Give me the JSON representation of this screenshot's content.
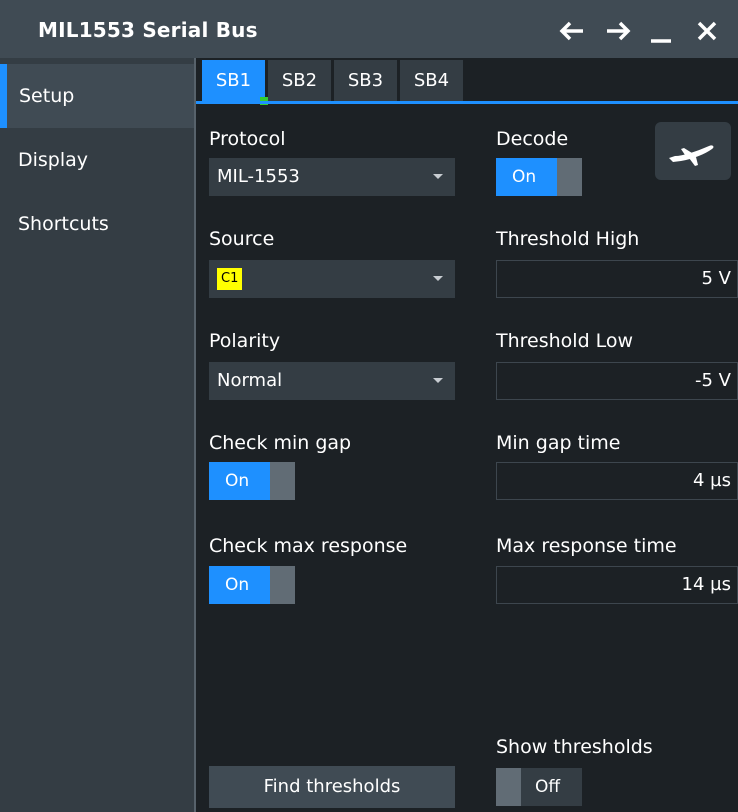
{
  "window": {
    "title": "MIL1553 Serial Bus",
    "controls": [
      "back-arrow-icon",
      "forward-arrow-icon",
      "minimize-icon",
      "close-icon"
    ]
  },
  "sidebar": {
    "items": [
      {
        "label": "Setup",
        "active": true
      },
      {
        "label": "Display",
        "active": false
      },
      {
        "label": "Shortcuts",
        "active": false
      }
    ]
  },
  "tabs": [
    {
      "label": "SB1",
      "active": true
    },
    {
      "label": "SB2",
      "active": false
    },
    {
      "label": "SB3",
      "active": false
    },
    {
      "label": "SB4",
      "active": false
    }
  ],
  "form": {
    "protocol": {
      "label": "Protocol",
      "value": "MIL-1553"
    },
    "decode": {
      "label": "Decode",
      "value": "On"
    },
    "source": {
      "label": "Source",
      "value": "C1"
    },
    "threshold_high": {
      "label": "Threshold High",
      "value": "5 V"
    },
    "polarity": {
      "label": "Polarity",
      "value": "Normal"
    },
    "threshold_low": {
      "label": "Threshold Low",
      "value": "-5 V"
    },
    "check_min_gap": {
      "label": "Check min gap",
      "value": "On"
    },
    "min_gap_time": {
      "label": "Min gap time",
      "value": "4 µs"
    },
    "check_max_response": {
      "label": "Check max response",
      "value": "On"
    },
    "max_response_time": {
      "label": "Max response time",
      "value": "14 µs"
    },
    "show_thresholds": {
      "label": "Show thresholds",
      "value": "Off"
    },
    "find_thresholds": {
      "label": "Find thresholds"
    }
  },
  "colors": {
    "accent": "#1e90ff",
    "source_chip": "#ffff00",
    "status_dot": "#32cd32",
    "title_bg": "#404b54",
    "sidebar_bg": "#343d44",
    "content_bg": "#1c2125"
  }
}
